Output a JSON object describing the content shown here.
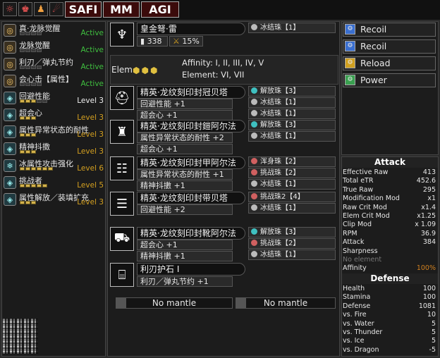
{
  "tabs": {
    "safi": "SAFI",
    "mm": "MM",
    "agi": "AGI"
  },
  "skills": [
    {
      "name": "真·龙脉觉醒",
      "level": "Active",
      "color": "#3fbf3f",
      "pips": 0,
      "maxpips": 0,
      "icon": "ring-icon"
    },
    {
      "name": "龙脉觉醒",
      "level": "Active",
      "color": "#3fbf3f",
      "pips": 0,
      "maxpips": 0,
      "icon": "ring-icon"
    },
    {
      "name": "利刃／弹丸节约",
      "level": "Active",
      "color": "#3fbf3f",
      "pips": 0,
      "maxpips": 0,
      "icon": "ring-icon"
    },
    {
      "name": "会心击【属性】",
      "level": "Active",
      "color": "#3fbf3f",
      "pips": 0,
      "maxpips": 0,
      "icon": "ring-icon"
    },
    {
      "name": "回避性能",
      "level": "Level 3",
      "color": "#f0f0f0",
      "pips": 3,
      "maxpips": 5,
      "icon": "dodge-icon"
    },
    {
      "name": "超会心",
      "level": "Level 3",
      "color": "#d4a020",
      "pips": 3,
      "maxpips": 3,
      "icon": "crit-icon"
    },
    {
      "name": "属性异常状态的耐性",
      "level": "Level 3",
      "color": "#d4a020",
      "pips": 3,
      "maxpips": 3,
      "icon": "status-icon"
    },
    {
      "name": "精神抖擞",
      "level": "Level 3",
      "color": "#d4a020",
      "pips": 3,
      "maxpips": 3,
      "icon": "spirit-icon"
    },
    {
      "name": "冰属性攻击强化",
      "level": "Level 6",
      "color": "#d4a020",
      "pips": 6,
      "maxpips": 6,
      "icon": "ice-icon"
    },
    {
      "name": "挑战者",
      "level": "Level 5",
      "color": "#d4a020",
      "pips": 5,
      "maxpips": 5,
      "icon": "challenger-icon"
    },
    {
      "name": "属性解放／装填扩充",
      "level": "Level 3",
      "color": "#d4a020",
      "pips": 3,
      "maxpips": 3,
      "icon": "reload-icon"
    }
  ],
  "weapon": {
    "name": "皇金弩·雷",
    "attack": "338",
    "affinity_pct": "15%",
    "deco": "冰结珠【1】",
    "elem_label": "Elem",
    "affinity_text": "Affinity:   I, II, III, IV, V",
    "element_text": "Element:  VI, VII"
  },
  "armor": [
    {
      "name": "精英·龙纹刻印封冠贝塔",
      "skills": [
        "回避性能 +1",
        "超会心 +1"
      ],
      "decos": [
        "解放珠【3】",
        "冰结珠【1】",
        "冰结珠【1】"
      ],
      "deco_colors": [
        "#3fc0c0",
        "#bbb",
        "#bbb"
      ]
    },
    {
      "name": "精英·龙纹刻印封鎧阿尔法",
      "skills": [
        "属性异常状态的耐性 +2",
        "超会心 +1"
      ],
      "decos": [
        "解放珠【3】",
        "冰结珠【1】"
      ],
      "deco_colors": [
        "#3fc0c0",
        "#bbb"
      ]
    },
    {
      "name": "精英·龙纹刻印封甲阿尔法",
      "skills": [
        "属性异常状态的耐性 +1",
        "精神抖擻 +1"
      ],
      "decos": [
        "浑身珠【2】",
        "挑战珠【2】",
        "冰结珠【1】"
      ],
      "deco_colors": [
        "#d06060",
        "#d06060",
        "#bbb"
      ]
    },
    {
      "name": "精英·龙纹刻印封带贝塔",
      "skills": [
        "回避性能 +2"
      ],
      "decos": [
        "挑战珠2【4】",
        "冰结珠【1】"
      ],
      "deco_colors": [
        "#d06060",
        "#bbb"
      ]
    },
    {
      "name": "精英·龙纹刻印封靴阿尔法",
      "skills": [
        "超会心 +1",
        "精神抖擻 +1"
      ],
      "decos": [
        "解放珠【3】",
        "挑战珠【2】",
        "冰结珠【1】"
      ],
      "deco_colors": [
        "#3fc0c0",
        "#d06060",
        "#bbb"
      ]
    }
  ],
  "charm": {
    "name": "利刃护石 I",
    "skill": "利刃／弹丸节约 +1"
  },
  "mantles": [
    "No mantle",
    "No mantle"
  ],
  "mods": [
    {
      "label": "Recoil",
      "color": "#3a6fd0"
    },
    {
      "label": "Recoil",
      "color": "#3a6fd0"
    },
    {
      "label": "Reload",
      "color": "#d0a020"
    },
    {
      "label": "Power",
      "color": "#3aa050"
    }
  ],
  "attack_header": "Attack",
  "attack_stats": [
    [
      "Effective Raw",
      "413"
    ],
    [
      "Total eTR",
      "452.6"
    ],
    [
      "True Raw",
      "295"
    ],
    [
      "Modification Mod",
      "x1"
    ],
    [
      "Raw Crit Mod",
      "x1.4"
    ],
    [
      "Elem Crit Mod",
      "x1.25"
    ],
    [
      "Clip Mod",
      "x 1.09"
    ],
    [
      "RPM",
      "36.9"
    ],
    [
      "Attack",
      "384"
    ],
    [
      "Sharpness",
      ""
    ],
    [
      "No element",
      ""
    ],
    [
      "Affinity",
      "100%"
    ]
  ],
  "defense_header": "Defense",
  "defense_stats": [
    [
      "Health",
      "100"
    ],
    [
      "Stamina",
      "100"
    ],
    [
      "Defense",
      "1081"
    ],
    [
      "vs. Fire",
      "10"
    ],
    [
      "vs. Water",
      "5"
    ],
    [
      "vs. Thunder",
      "5"
    ],
    [
      "vs. Ice",
      "5"
    ],
    [
      "vs. Dragon",
      "-5"
    ]
  ]
}
